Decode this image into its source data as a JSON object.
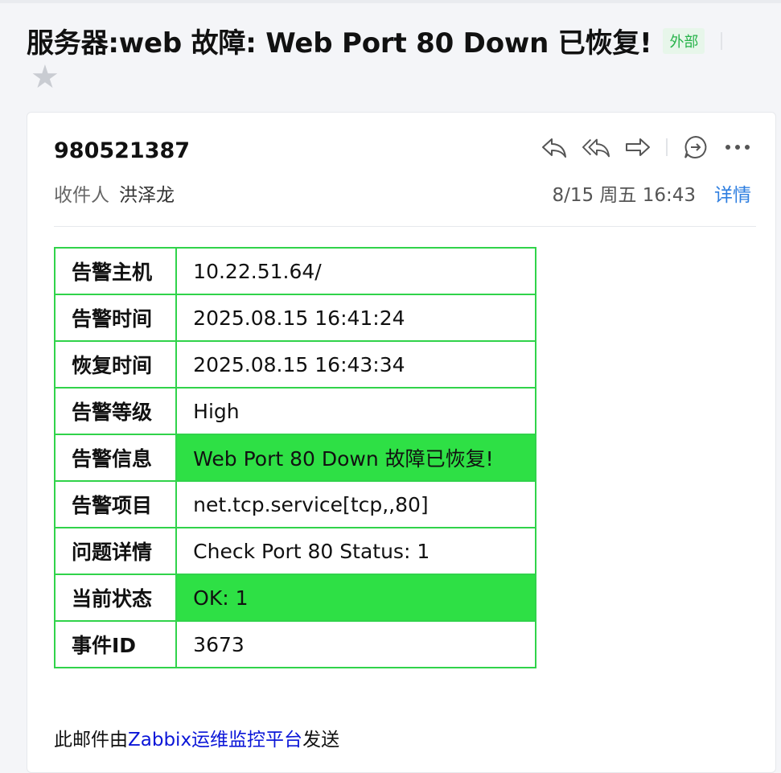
{
  "subject": "服务器:web 故障: Web Port 80 Down 已恢复!",
  "subject_tag": "外部",
  "star_icon": "star-icon",
  "sender": "980521387",
  "recipient_label": "收件人",
  "recipient_name": "洪泽龙",
  "date": "8/15 周五 16:43",
  "details_link": "详情",
  "actions": [
    "reply-icon",
    "reply-all-icon",
    "forward-icon",
    "comment-icon",
    "more-icon"
  ],
  "table": {
    "rows": [
      {
        "key": "告警主机",
        "value": "10.22.51.64/"
      },
      {
        "key": "告警时间",
        "value": "2025.08.15 16:41:24"
      },
      {
        "key": "恢复时间",
        "value": "2025.08.15 16:43:34"
      },
      {
        "key": "告警等级",
        "value": "High"
      },
      {
        "key": "告警信息",
        "value": "Web Port 80 Down 故障已恢复!"
      },
      {
        "key": "告警项目",
        "value": "net.tcp.service[tcp,,80]"
      },
      {
        "key": "问题详情",
        "value": "Check Port 80 Status: 1"
      },
      {
        "key": "当前状态",
        "value": "OK: 1"
      },
      {
        "key": "事件ID",
        "value": "3673"
      }
    ]
  },
  "footer": {
    "prefix": "此邮件由",
    "link": "Zabbix运维监控平台",
    "suffix": "发送"
  },
  "colors": {
    "highlight": "#2ee045",
    "table_border": "#30d34a",
    "link": "#0b16d8",
    "tag_text": "#27b34a",
    "details_link": "#2f7fe0"
  }
}
